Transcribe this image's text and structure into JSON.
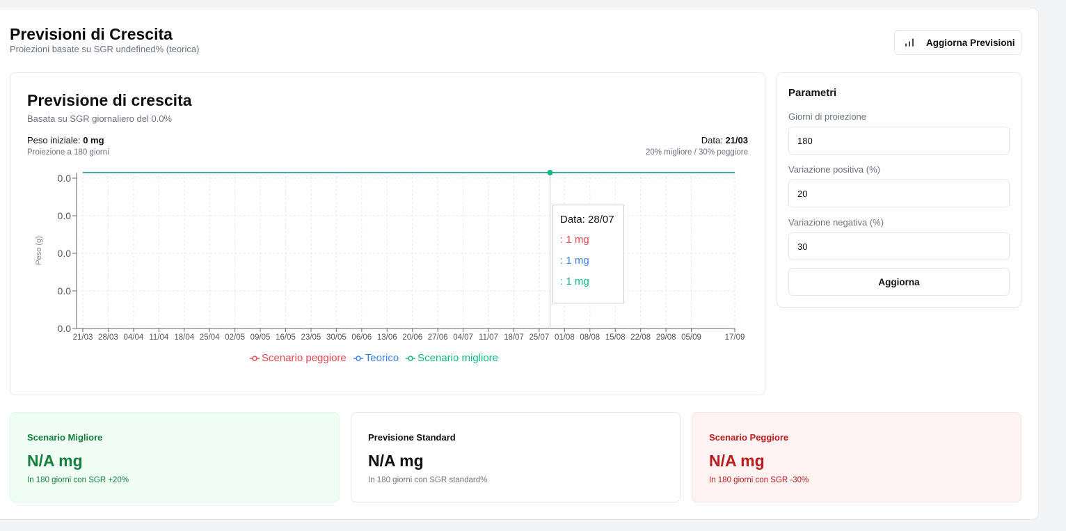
{
  "header": {
    "title": "Previsioni di Crescita",
    "subtitle": "Proiezioni basate su SGR undefined% (teorica)",
    "refresh_label": "Aggiorna Previsioni"
  },
  "chart_card": {
    "title": "Previsione di crescita",
    "subtitle": "Basata su SGR giornaliero del 0.0%",
    "initial_weight_label": "Peso iniziale: ",
    "initial_weight_value": "0 mg",
    "projection_note": "Proiezione a 180 giorni",
    "date_label": "Data: ",
    "date_value": "21/03",
    "scenario_note": "20% migliore / 30% peggiore"
  },
  "tooltip": {
    "header": "Data: 28/07",
    "rows": [
      ": 1 mg",
      ": 1 mg",
      ": 1 mg"
    ]
  },
  "chart_data": {
    "type": "line",
    "ylabel": "Peso (g)",
    "y_ticks": [
      "0.0",
      "0.0",
      "0.0",
      "0.0",
      "0.0"
    ],
    "x": [
      "21/03",
      "28/03",
      "04/04",
      "11/04",
      "18/04",
      "25/04",
      "02/05",
      "09/05",
      "16/05",
      "23/05",
      "30/05",
      "06/06",
      "13/06",
      "20/06",
      "27/06",
      "04/07",
      "11/07",
      "18/07",
      "25/07",
      "01/08",
      "08/08",
      "15/08",
      "22/08",
      "29/08",
      "05/09",
      "17/09"
    ],
    "x_day_offsets": [
      0,
      7,
      14,
      21,
      28,
      35,
      42,
      49,
      56,
      63,
      70,
      77,
      84,
      91,
      98,
      105,
      112,
      119,
      126,
      133,
      140,
      147,
      154,
      161,
      168,
      180
    ],
    "x_range_days": [
      0,
      180
    ],
    "series": [
      {
        "name": "Scenario peggiore",
        "color": "#e5484d",
        "value": 0
      },
      {
        "name": "Teorico",
        "color": "#3b82f6",
        "value": 0
      },
      {
        "name": "Scenario migliore",
        "color": "#10b981",
        "value": 0
      }
    ],
    "active_point_day": 129,
    "grid": true,
    "legend_position": "bottom"
  },
  "params": {
    "title": "Parametri",
    "days_label": "Giorni di proiezione",
    "days_value": "180",
    "positive_label": "Variazione positiva (%)",
    "positive_value": "20",
    "negative_label": "Variazione negativa (%)",
    "negative_value": "30",
    "apply_label": "Aggiorna"
  },
  "summary": {
    "best": {
      "title": "Scenario Migliore",
      "value": "N/A mg",
      "note": "In 180 giorni con SGR +20%"
    },
    "standard": {
      "title": "Previsione Standard",
      "value": "N/A mg",
      "note": "In 180 giorni con SGR standard%"
    },
    "worst": {
      "title": "Scenario Peggiore",
      "value": "N/A mg",
      "note": "In 180 giorni con SGR -30%"
    }
  },
  "colors": {
    "best": "#15803d",
    "worst": "#b91c1c",
    "line": "#14a0a8"
  }
}
